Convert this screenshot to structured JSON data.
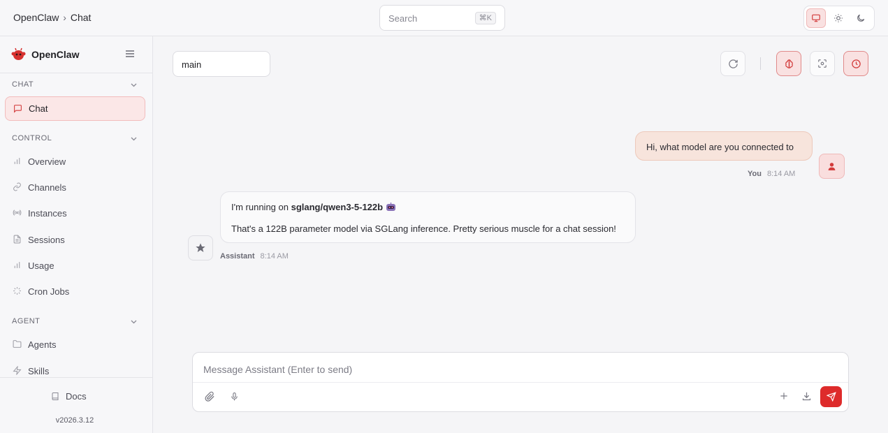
{
  "topbar": {
    "breadcrumb_app": "OpenClaw",
    "breadcrumb_sep": "›",
    "breadcrumb_page": "Chat",
    "search_placeholder": "Search",
    "search_shortcut": "⌘K",
    "theme_options": [
      "system-icon",
      "sun-icon",
      "moon-icon"
    ],
    "theme_selected": "system"
  },
  "sidebar": {
    "brand": "OpenClaw",
    "sections": [
      {
        "title": "CHAT",
        "items": [
          {
            "label": "Chat",
            "icon": "message-icon",
            "active": true
          }
        ]
      },
      {
        "title": "CONTROL",
        "items": [
          {
            "label": "Overview",
            "icon": "bar-chart-icon"
          },
          {
            "label": "Channels",
            "icon": "link-icon"
          },
          {
            "label": "Instances",
            "icon": "radio-icon"
          },
          {
            "label": "Sessions",
            "icon": "file-icon"
          },
          {
            "label": "Usage",
            "icon": "bar-chart-icon"
          },
          {
            "label": "Cron Jobs",
            "icon": "loader-icon"
          }
        ]
      },
      {
        "title": "AGENT",
        "items": [
          {
            "label": "Agents",
            "icon": "folder-icon"
          },
          {
            "label": "Skills",
            "icon": "zap-icon"
          }
        ]
      }
    ],
    "footer": {
      "docs": "Docs",
      "version": "v2026.3.12"
    }
  },
  "main": {
    "session": "main",
    "toolbar_icons": [
      "refresh-icon",
      "brain-icon",
      "focus-icon",
      "clock-icon"
    ],
    "messages": [
      {
        "role": "user",
        "author": "You",
        "time": "8:14 AM",
        "text": "Hi, what model are you connected to"
      },
      {
        "role": "assistant",
        "author": "Assistant",
        "time": "8:14 AM",
        "line1_prefix": "I'm running on ",
        "line1_bold": "sglang/qwen3-5-122b",
        "line2": "That's a 122B parameter model via SGLang inference. Pretty serious muscle for a chat session!"
      }
    ],
    "composer": {
      "placeholder": "Message Assistant (Enter to send)"
    }
  },
  "colors": {
    "accent": "#de2b2b",
    "accent_soft": "#fbe7e7",
    "user_bubble": "#f7e4dc"
  }
}
